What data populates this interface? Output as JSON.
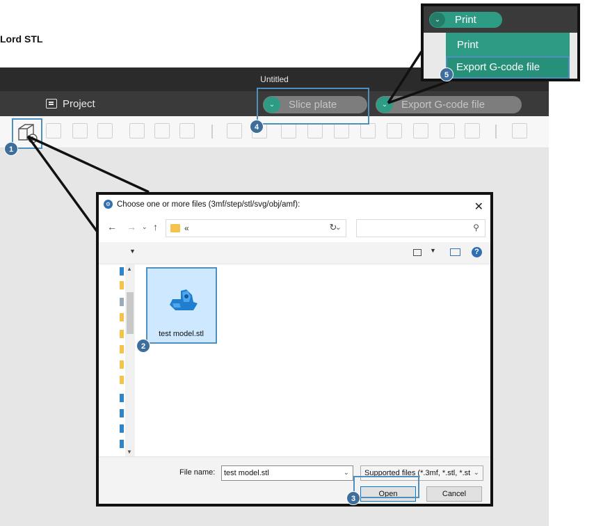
{
  "heading": "Lord STL",
  "app": {
    "window_title": "Untitled",
    "project_label": "Project",
    "slice_button": "Slice plate",
    "export_button": "Export G-code file",
    "toolbar_icons": [
      "add-model-icon",
      "add-plate-icon",
      "auto-orient-icon",
      "arrange-icon",
      "copy-icon",
      "paste-icon",
      "layers-icon",
      "move-icon",
      "rotate-icon",
      "scale-icon",
      "lay-on-face-icon",
      "cut-icon",
      "split-icon",
      "boolean-icon",
      "support-paint-icon",
      "seam-paint-icon",
      "text-icon",
      "measure-icon",
      "assembly-icon"
    ]
  },
  "print_menu": {
    "button_label": "Print",
    "items": [
      "Print",
      "Export G-code file"
    ]
  },
  "dialog": {
    "title": "Choose one or more files (3mf/step/stl/svg/obj/amf):",
    "close_glyph": "✕",
    "address_crumb": "«",
    "file": {
      "name": "test model.stl"
    },
    "file_name_label": "File name:",
    "file_name_value": "test model.stl",
    "file_type_value": "Supported files (*.3mf, *.stl, *.st",
    "open_label": "Open",
    "cancel_label": "Cancel"
  },
  "badges": [
    "1",
    "2",
    "3",
    "4",
    "5"
  ],
  "colors": {
    "accent_green": "#2e9c84",
    "highlight_blue": "#4e8fc0",
    "badge_blue": "#3e6f9c"
  }
}
